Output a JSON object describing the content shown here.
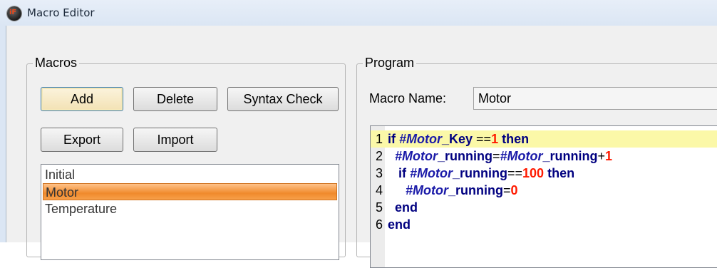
{
  "window": {
    "title": "Macro Editor",
    "icon": "app-logo-icon",
    "icon_text": "iF"
  },
  "macros": {
    "label": "Macros",
    "buttons": {
      "add": "Add",
      "delete": "Delete",
      "syntax_check": "Syntax Check",
      "export": "Export",
      "import": "Import"
    },
    "items": [
      "Initial",
      "Motor",
      "Temperature"
    ],
    "selected": "Motor",
    "selection_color": "#f08a2c"
  },
  "program": {
    "label": "Program",
    "macro_name_label": "Macro Name:",
    "macro_name_value": "Motor",
    "current_line_color": "#fbf8a8",
    "lines": [
      {
        "num": "1",
        "tokens": [
          [
            "if ",
            "kw"
          ],
          [
            "#Motor",
            "var"
          ],
          [
            "_Key ",
            "id"
          ],
          [
            "==",
            "op"
          ],
          [
            "1",
            "num"
          ],
          [
            " then",
            "kw"
          ]
        ]
      },
      {
        "num": "2",
        "tokens": [
          [
            "  #Motor",
            "var"
          ],
          [
            "_running",
            "id"
          ],
          [
            "=",
            "op"
          ],
          [
            "#Motor",
            "var"
          ],
          [
            "_running",
            "id"
          ],
          [
            "+",
            "op"
          ],
          [
            "1",
            "num"
          ]
        ]
      },
      {
        "num": "3",
        "tokens": [
          [
            "   if ",
            "kw"
          ],
          [
            "#Motor",
            "var"
          ],
          [
            "_running",
            "id"
          ],
          [
            "==",
            "op"
          ],
          [
            "100",
            "num"
          ],
          [
            " then",
            "kw"
          ]
        ]
      },
      {
        "num": "4",
        "tokens": [
          [
            "     #Motor",
            "var"
          ],
          [
            "_running",
            "id"
          ],
          [
            "=",
            "op"
          ],
          [
            "0",
            "num"
          ]
        ]
      },
      {
        "num": "5",
        "tokens": [
          [
            "  end",
            "kw"
          ]
        ]
      },
      {
        "num": "6",
        "tokens": [
          [
            "end",
            "kw"
          ]
        ]
      }
    ]
  }
}
